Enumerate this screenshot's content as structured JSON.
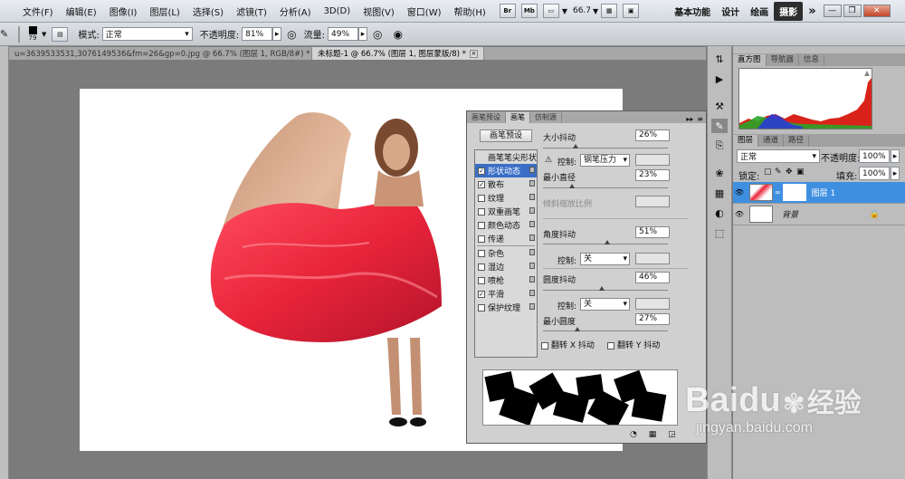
{
  "menubar": {
    "items": [
      "文件(F)",
      "编辑(E)",
      "图像(I)",
      "图层(L)",
      "选择(S)",
      "滤镜(T)",
      "分析(A)",
      "3D(D)",
      "视图(V)",
      "窗口(W)",
      "帮助(H)"
    ],
    "tb": [
      "Br",
      "Mb"
    ],
    "zoom": "66.7",
    "workspaces": [
      "基本功能",
      "设计",
      "绘画",
      "摄影"
    ],
    "more": "»"
  },
  "options": {
    "brush_size": "79",
    "mode_label": "模式:",
    "mode_value": "正常",
    "opacity_label": "不透明度:",
    "opacity_value": "81%",
    "flow_label": "流量:",
    "flow_value": "49%"
  },
  "tabs": [
    {
      "label": "u=3639533531,3076149536&fm=26&gp=0.jpg @ 66.7% (图层 1, RGB/8#) *"
    },
    {
      "label": "未标题-1 @ 66.7% (图层 1, 图层蒙版/8) *"
    }
  ],
  "brush": {
    "tabs": [
      "画笔预设",
      "画笔",
      "仿制源"
    ],
    "preset_button": "画笔预设",
    "options": [
      {
        "label": "画笔笔尖形状",
        "checkbox": false,
        "checked": false,
        "active": false
      },
      {
        "label": "形状动态",
        "checkbox": true,
        "checked": true,
        "active": true
      },
      {
        "label": "散布",
        "checkbox": true,
        "checked": true,
        "active": false
      },
      {
        "label": "纹理",
        "checkbox": true,
        "checked": false,
        "active": false
      },
      {
        "label": "双重画笔",
        "checkbox": true,
        "checked": false,
        "active": false
      },
      {
        "label": "颜色动态",
        "checkbox": true,
        "checked": false,
        "active": false
      },
      {
        "label": "传递",
        "checkbox": true,
        "checked": false,
        "active": false
      },
      {
        "label": "杂色",
        "checkbox": true,
        "checked": false,
        "active": false
      },
      {
        "label": "湿边",
        "checkbox": true,
        "checked": false,
        "active": false
      },
      {
        "label": "喷枪",
        "checkbox": true,
        "checked": false,
        "active": false
      },
      {
        "label": "平滑",
        "checkbox": true,
        "checked": true,
        "active": false
      },
      {
        "label": "保护纹理",
        "checkbox": true,
        "checked": false,
        "active": false
      }
    ],
    "size_jitter_label": "大小抖动",
    "size_jitter": "26%",
    "control_label": "控制:",
    "control1": "钢笔压力",
    "min_diameter_label": "最小直径",
    "min_diameter": "23%",
    "tilt_label": "倾斜缩放比例",
    "angle_jitter_label": "角度抖动",
    "angle_jitter": "51%",
    "control2": "关",
    "roundness_jitter_label": "圆度抖动",
    "roundness_jitter": "46%",
    "control3": "关",
    "min_roundness_label": "最小圆度",
    "min_roundness": "27%",
    "flip_x": "翻转 X 抖动",
    "flip_y": "翻转 Y 抖动"
  },
  "histogram": {
    "tabs": [
      "直方图",
      "导航器",
      "信息"
    ]
  },
  "layers": {
    "tabs": [
      "图层",
      "通道",
      "路径"
    ],
    "blend_mode": "正常",
    "opacity_label": "不透明度:",
    "opacity_value": "100%",
    "lock_label": "锁定:",
    "fill_label": "填充:",
    "fill_value": "100%",
    "rows": [
      {
        "name": "图层 1",
        "selected": true
      },
      {
        "name": "背景",
        "selected": false
      }
    ]
  },
  "watermark": {
    "brand": "Baidu",
    "brand_cn": "经验",
    "url": "jingyan.baidu.com"
  }
}
